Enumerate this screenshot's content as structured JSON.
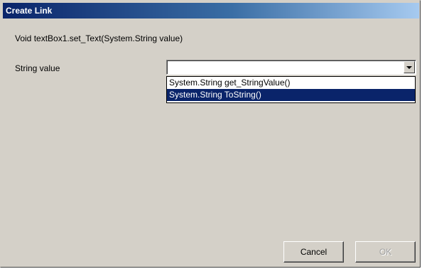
{
  "window": {
    "title": "Create Link"
  },
  "dialog": {
    "signature": "Void  textBox1.set_Text(System.String  value)",
    "parameter_label": "String value",
    "combo_value": "",
    "options": [
      {
        "label": "System.String get_StringValue()",
        "selected": false
      },
      {
        "label": "System.String ToString()",
        "selected": true
      }
    ]
  },
  "buttons": {
    "cancel_label": "Cancel",
    "ok_label": "OK",
    "ok_enabled": false
  },
  "colors": {
    "title_start": "#0a246a",
    "title_end": "#a6caf0",
    "selection": "#0a246a",
    "face": "#d4d0c8"
  }
}
